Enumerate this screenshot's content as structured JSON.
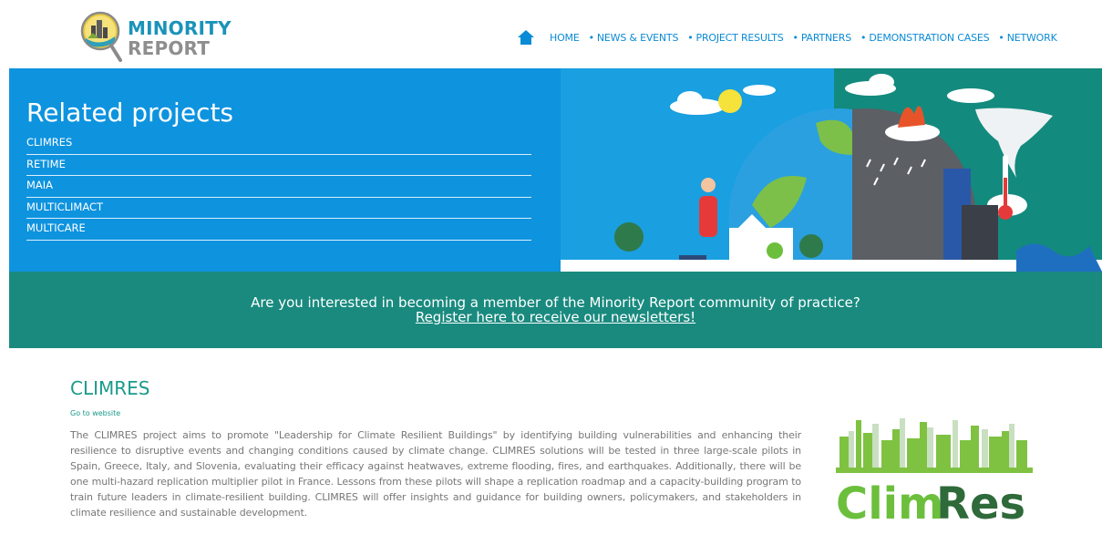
{
  "brand": {
    "name_line1": "MINORITY",
    "name_line2": "REPORT"
  },
  "nav": {
    "items": [
      {
        "label": "HOME",
        "prefix": ""
      },
      {
        "label": "NEWS & EVENTS",
        "prefix": "•"
      },
      {
        "label": "PROJECT RESULTS",
        "prefix": "•"
      },
      {
        "label": "PARTNERS",
        "prefix": "•"
      },
      {
        "label": "DEMONSTRATION CASES",
        "prefix": "•"
      },
      {
        "label": "NETWORK",
        "prefix": "•"
      }
    ]
  },
  "hero": {
    "title": "Related projects",
    "projects": [
      "CLIMRES",
      "RETIME",
      "MAIA",
      "MULTICLIMACT",
      "MULTICARE"
    ]
  },
  "banner": {
    "question": "Are you interested in becoming a member of the Minority Report community of practice?",
    "register_link": "Register here to receive our newsletters!"
  },
  "section": {
    "title": "CLIMRES",
    "go_to_website": "Go to website",
    "description": "The CLIMRES project aims to promote \"Leadership for Climate Resilient Buildings\" by identifying building vulnerabilities and enhancing their resilience to disruptive events and changing conditions caused by climate change. CLIMRES solutions will be tested in three large-scale pilots in Spain, Greece, Italy, and Slovenia, evaluating their efficacy against heatwaves, extreme flooding, fires, and earthquakes. Additionally, there will be one multi-hazard replication multiplier pilot in France. Lessons from these pilots will shape a replication roadmap and a capacity-building program to train future leaders in climate-resilient building. CLIMRES will offer insights and guidance for building owners, policymakers, and stakeholders in climate resilience and sustainable development.",
    "logo_text_clim": "Clim",
    "logo_text_res": "Res"
  },
  "colors": {
    "hero_blue": "#0e93df",
    "banner_teal": "#1a8a7f",
    "nav_blue": "#0a8bd6",
    "title_teal": "#1a9a8a",
    "climres_green": "#6cbf3c"
  },
  "icons": {
    "home": "home-icon",
    "logo": "magnifier-city-logo"
  }
}
